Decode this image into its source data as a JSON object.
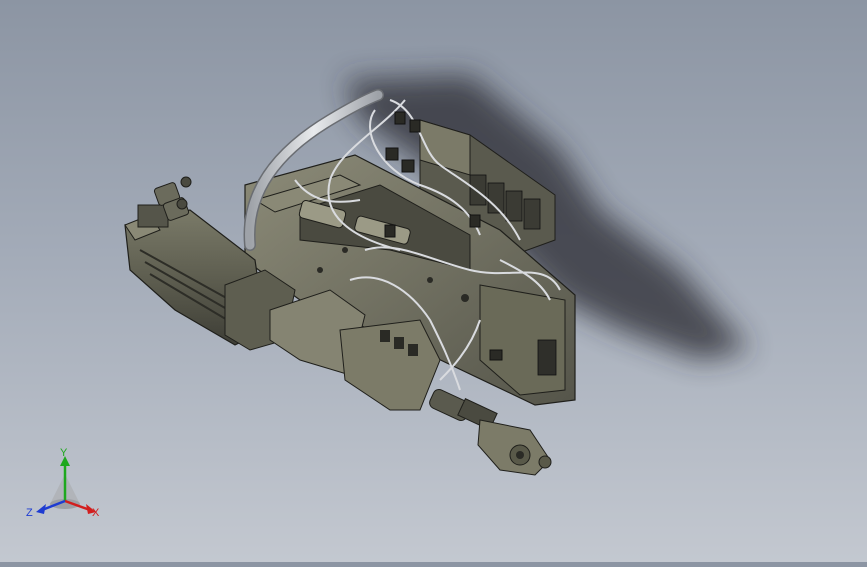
{
  "viewport": {
    "background_top": "#8c95a3",
    "background_bottom": "#c3c8d0",
    "model_body_color": "#6f6e5c",
    "model_dark_color": "#3b3b34",
    "tube_color": "#c9ccd0",
    "shadow_color": "#2a2c30"
  },
  "triad": {
    "x_label": "X",
    "y_label": "Y",
    "z_label": "Z",
    "x_color": "#d21e1e",
    "y_color": "#1ea81e",
    "z_color": "#1e3cd2"
  }
}
